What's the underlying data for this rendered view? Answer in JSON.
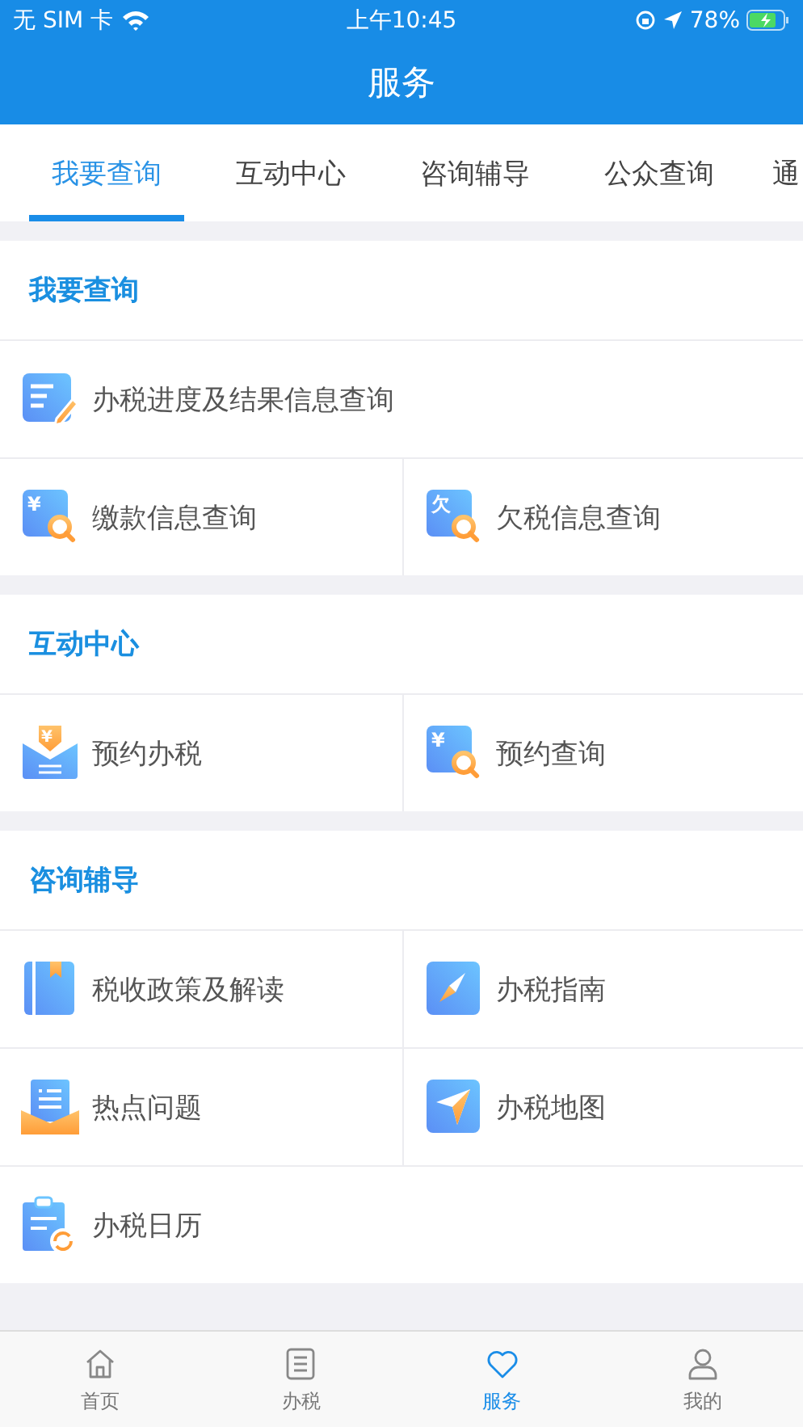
{
  "status_bar": {
    "carrier": "无 SIM 卡",
    "time": "上午10:45",
    "battery": "78%"
  },
  "header": {
    "title": "服务"
  },
  "tabs": [
    {
      "label": "我要查询",
      "selected": true
    },
    {
      "label": "互动中心",
      "selected": false
    },
    {
      "label": "咨询辅导",
      "selected": false
    },
    {
      "label": "公众查询",
      "selected": false
    },
    {
      "label": "通",
      "selected": false
    }
  ],
  "sections": [
    {
      "title": "我要查询",
      "rows": [
        [
          {
            "label": "办税进度及结果信息查询",
            "kind": "edit"
          }
        ],
        [
          {
            "label": "缴款信息查询",
            "kind": "search",
            "glyph": "¥"
          },
          {
            "label": "欠税信息查询",
            "kind": "search",
            "glyph": "欠"
          }
        ]
      ]
    },
    {
      "title": "互动中心",
      "rows": [
        [
          {
            "label": "预约办税",
            "kind": "envelope",
            "glyph": "¥"
          },
          {
            "label": "预约查询",
            "kind": "search",
            "glyph": "¥"
          }
        ]
      ]
    },
    {
      "title": "咨询辅导",
      "rows": [
        [
          {
            "label": "税收政策及解读",
            "kind": "book"
          },
          {
            "label": "办税指南",
            "kind": "compass"
          }
        ],
        [
          {
            "label": "热点问题",
            "kind": "mail"
          },
          {
            "label": "办税地图",
            "kind": "plane"
          }
        ],
        [
          {
            "label": "办税日历",
            "kind": "calendar"
          }
        ]
      ]
    }
  ],
  "bottom_nav": [
    {
      "label": "首页",
      "kind": "home",
      "selected": false
    },
    {
      "label": "办税",
      "kind": "list",
      "selected": false
    },
    {
      "label": "服务",
      "kind": "heart",
      "selected": true
    },
    {
      "label": "我的",
      "kind": "person",
      "selected": false
    }
  ]
}
